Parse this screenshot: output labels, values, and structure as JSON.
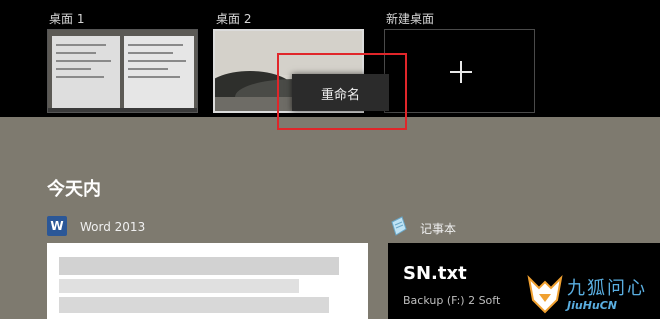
{
  "desktops": [
    {
      "label": "桌面 1"
    },
    {
      "label": "桌面 2"
    }
  ],
  "new_desktop": {
    "label": "新建桌面",
    "icon": "plus-icon"
  },
  "context_menu": {
    "rename_label": "重命名"
  },
  "timeline": {
    "section_title": "今天内",
    "word_app": {
      "icon_letter": "W",
      "name": "Word 2013"
    },
    "notepad_app": {
      "name": "记事本"
    },
    "notepad_card": {
      "title": "SN.txt",
      "subtitle": "Backup (F:) 2 Soft"
    }
  },
  "watermark": {
    "cn": "九狐问心",
    "en": "JiuHuCN"
  },
  "colors": {
    "highlight": "#e0262a",
    "word_blue": "#2b5797",
    "watermark_blue": "#5aaee0"
  }
}
